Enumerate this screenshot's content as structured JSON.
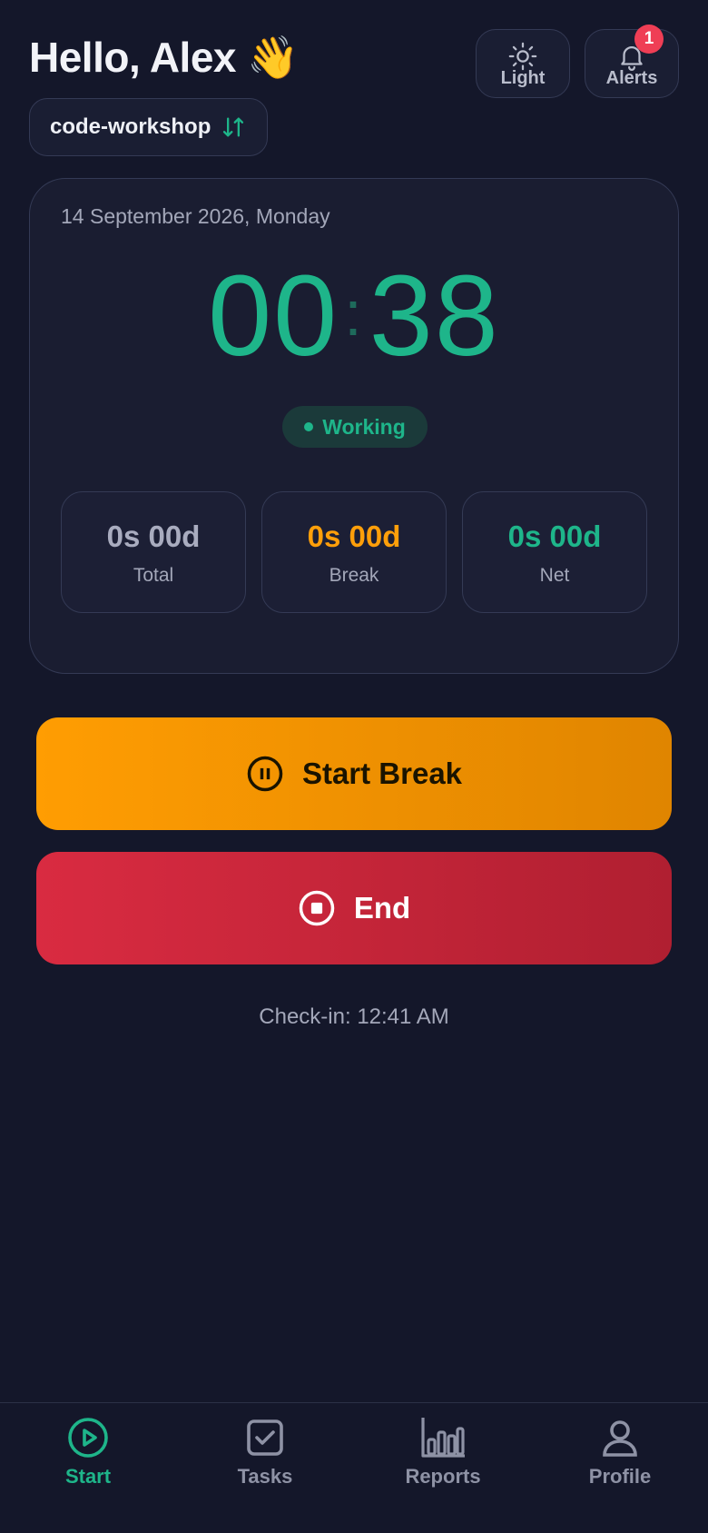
{
  "header": {
    "greeting": "Hello, Alex 👋",
    "theme_label": "Light",
    "alerts_label": "Alerts",
    "alerts_count": "1",
    "workspace": "code-workshop"
  },
  "card": {
    "date": "14 September 2026, Monday",
    "timer_minutes": "00",
    "timer_seconds": "38",
    "status": "Working",
    "stats": {
      "total": {
        "value": "0s 00d",
        "label": "Total"
      },
      "break": {
        "value": "0s 00d",
        "label": "Break"
      },
      "net": {
        "value": "0s 00d",
        "label": "Net"
      }
    }
  },
  "actions": {
    "start_break": "Start Break",
    "end": "End"
  },
  "checkin": "Check-in: 12:41 AM",
  "nav": {
    "start": "Start",
    "tasks": "Tasks",
    "reports": "Reports",
    "profile": "Profile"
  },
  "colors": {
    "background": "#14172a",
    "accent": "#1eb58a",
    "break": "#ff9f0a",
    "end": "#d92b41",
    "badge": "#ef3e55"
  },
  "icons": {
    "theme": "sun-icon",
    "alerts": "bell-icon",
    "workspace": "swap-arrows-icon",
    "break": "pause-circle-icon",
    "end": "stop-circle-icon",
    "nav_start": "play-circle-icon",
    "nav_tasks": "checkbox-icon",
    "nav_reports": "bar-chart-icon",
    "nav_profile": "user-icon"
  }
}
